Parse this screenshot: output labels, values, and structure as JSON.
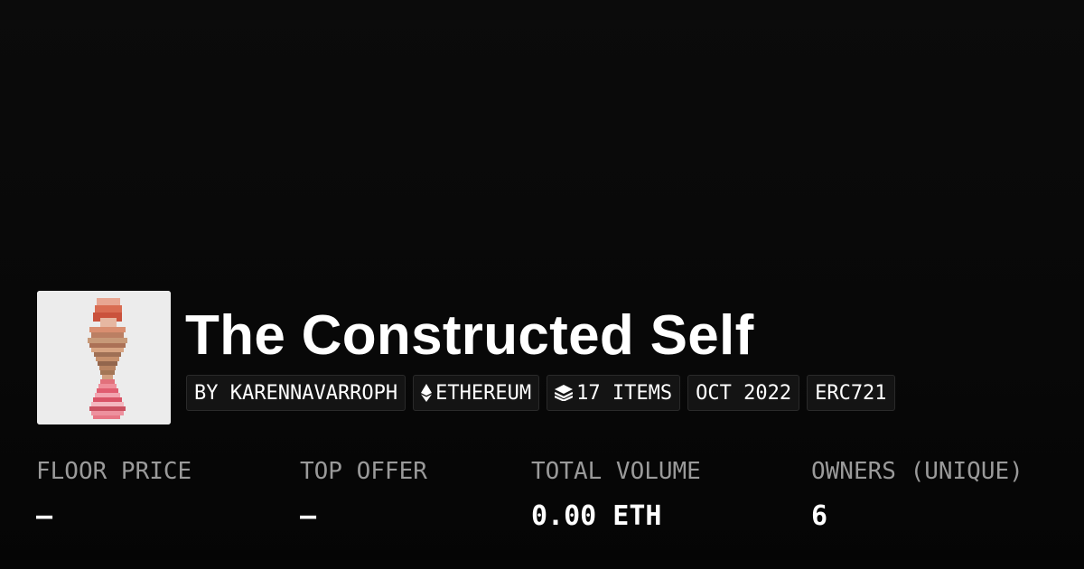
{
  "collection": {
    "title": "The Constructed Self",
    "thumbnail_alt": "collection-thumbnail"
  },
  "chips": {
    "creator": "BY KARENNAVARROPH",
    "chain": "ETHEREUM",
    "chain_icon": "ethereum-icon",
    "items": "17 ITEMS",
    "items_icon": "layers-icon",
    "date": "OCT 2022",
    "standard": "ERC721"
  },
  "stats": {
    "floor_price": {
      "label": "FLOOR PRICE",
      "value": "—"
    },
    "top_offer": {
      "label": "TOP OFFER",
      "value": "—"
    },
    "total_volume": {
      "label": "TOTAL VOLUME",
      "value": "0.00 ETH"
    },
    "owners": {
      "label": "OWNERS (UNIQUE)",
      "value": "6"
    }
  },
  "colors": {
    "background": "#0b0b0b",
    "chip_background": "#141414",
    "chip_border": "#2a2a2a",
    "label_gray": "#9a9a9a",
    "text_white": "#ffffff"
  }
}
